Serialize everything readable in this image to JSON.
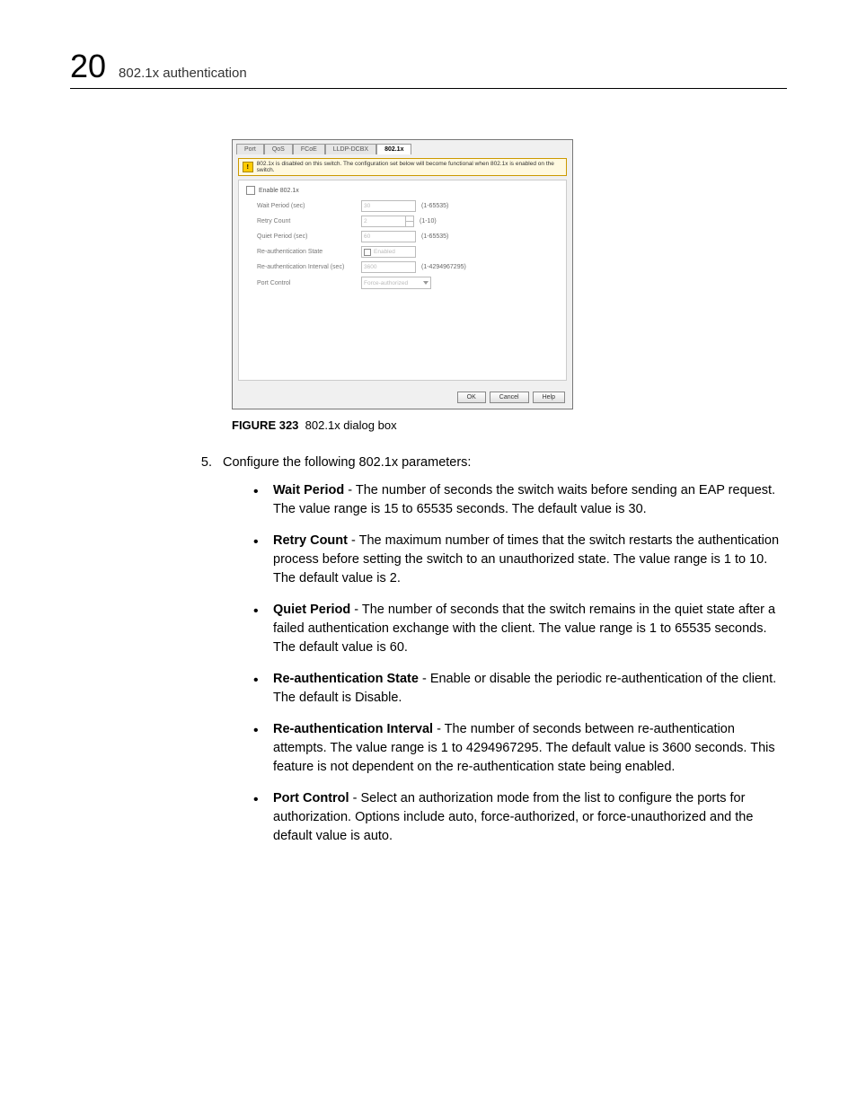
{
  "header": {
    "chapter_number": "20",
    "chapter_title": "802.1x authentication"
  },
  "figure": {
    "tabs": [
      "Port",
      "QoS",
      "FCoE",
      "LLDP-DCBX",
      "802.1x"
    ],
    "active_tab": "802.1x",
    "warning": "802.1x is disabled on this switch. The configuration set below will become functional when 802.1x is enabled on the switch.",
    "enable_label": "Enable 802.1x",
    "fields": {
      "wait_period": {
        "label": "Wait Period (sec)",
        "value": "30",
        "range": "(1-65535)"
      },
      "retry_count": {
        "label": "Retry Count",
        "value": "2",
        "range": "(1-10)"
      },
      "quiet_period": {
        "label": "Quiet Period (sec)",
        "value": "60",
        "range": "(1-65535)"
      },
      "reauth_state": {
        "label": "Re-authentication State",
        "value": "Enabled"
      },
      "reauth_interval": {
        "label": "Re-authentication Interval (sec)",
        "value": "3600",
        "range": "(1-4294967295)"
      },
      "port_control": {
        "label": "Port Control",
        "value": "Force-authorized"
      }
    },
    "buttons": {
      "ok": "OK",
      "cancel": "Cancel",
      "help": "Help"
    },
    "caption_label": "FIGURE 323",
    "caption_text": "802.1x dialog box"
  },
  "step": {
    "number": "5.",
    "text": "Configure the following 802.1x parameters:"
  },
  "bullets": [
    {
      "term": "Wait Period",
      "desc": " - The number of seconds the switch waits before sending an EAP request. The value range is 15 to 65535 seconds. The default value is 30."
    },
    {
      "term": "Retry Count",
      "desc": " - The maximum number of times that the switch restarts the authentication process before setting the switch to an unauthorized state. The value range is 1 to 10. The default value is 2."
    },
    {
      "term": "Quiet Period",
      "desc": " - The number of seconds that the switch remains in the quiet state after a failed authentication exchange with the client. The value range is 1 to 65535 seconds. The default value is 60."
    },
    {
      "term": "Re-authentication State",
      "desc": " - Enable or disable the periodic re-authentication of the client. The default is Disable."
    },
    {
      "term": "Re-authentication Interval",
      "desc": " - The number of seconds between re-authentication attempts. The value range is 1 to 4294967295. The default value is 3600 seconds. This feature is not dependent on the re-authentication state being enabled."
    },
    {
      "term": "Port Control",
      "desc": " - Select an authorization mode from the list to configure the ports for authorization. Options include auto, force-authorized, or force-unauthorized and the default value is auto."
    }
  ]
}
